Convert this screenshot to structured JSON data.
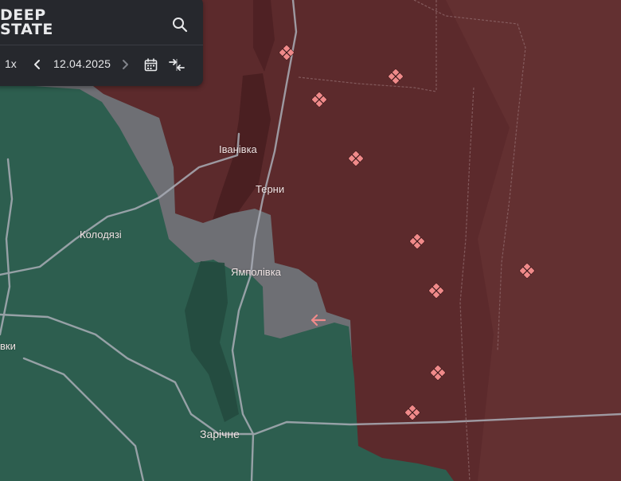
{
  "app": {
    "logo_line1": "DEEP",
    "logo_line2": "STATE"
  },
  "toolbar": {
    "speed": "1x",
    "date": "12.04.2025",
    "search_icon": "search-icon",
    "prev_icon": "chevron-left-icon",
    "next_icon": "chevron-right-icon",
    "calendar_icon": "calendar-icon",
    "compare_icon": "compare-arrows-icon"
  },
  "map": {
    "colors": {
      "occupied": "#5c2a2c",
      "occupied_dark": "#4a1f21",
      "liberated": "#2d5e4f",
      "contested": "#6e6f74",
      "roads": "#a9adb6",
      "markers": "#f08a8a"
    },
    "places": [
      "Іванівка",
      "Терни",
      "Колодязі",
      "Ямполівка",
      "вки",
      "Зарічне"
    ],
    "marker_count": 10,
    "arrow_icons": [
      "arrow-left-icon",
      "arrow-left-icon"
    ]
  }
}
